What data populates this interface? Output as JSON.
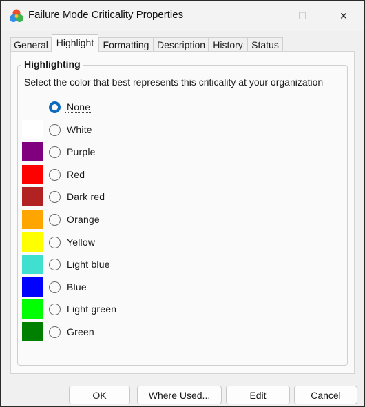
{
  "window": {
    "title": "Failure Mode Criticality Properties",
    "minimize_glyph": "—",
    "maximize_glyph": "☐",
    "close_glyph": "✕"
  },
  "tabs": [
    {
      "label": "General"
    },
    {
      "label": "Highlight",
      "active": true
    },
    {
      "label": "Formatting"
    },
    {
      "label": "Description"
    },
    {
      "label": "History"
    },
    {
      "label": "Status"
    }
  ],
  "highlighting": {
    "group_label": "Highlighting",
    "instruction": "Select the color that best represents this criticality at your organization",
    "selected": "None",
    "options": [
      {
        "label": "None",
        "color": null,
        "checked": true
      },
      {
        "label": "White",
        "color": "#ffffff",
        "checked": false
      },
      {
        "label": "Purple",
        "color": "#800080",
        "checked": false
      },
      {
        "label": "Red",
        "color": "#ff0000",
        "checked": false
      },
      {
        "label": "Dark red",
        "color": "#b22222",
        "checked": false
      },
      {
        "label": "Orange",
        "color": "#ffa500",
        "checked": false
      },
      {
        "label": "Yellow",
        "color": "#ffff00",
        "checked": false
      },
      {
        "label": "Light blue",
        "color": "#40e0d0",
        "checked": false
      },
      {
        "label": "Blue",
        "color": "#0000ff",
        "checked": false
      },
      {
        "label": "Light green",
        "color": "#00ff00",
        "checked": false
      },
      {
        "label": "Green",
        "color": "#008000",
        "checked": false
      }
    ]
  },
  "buttons": {
    "ok": "OK",
    "where_used": "Where Used...",
    "edit": "Edit",
    "cancel": "Cancel"
  },
  "colors": {
    "accent": "#0f6cbd"
  }
}
